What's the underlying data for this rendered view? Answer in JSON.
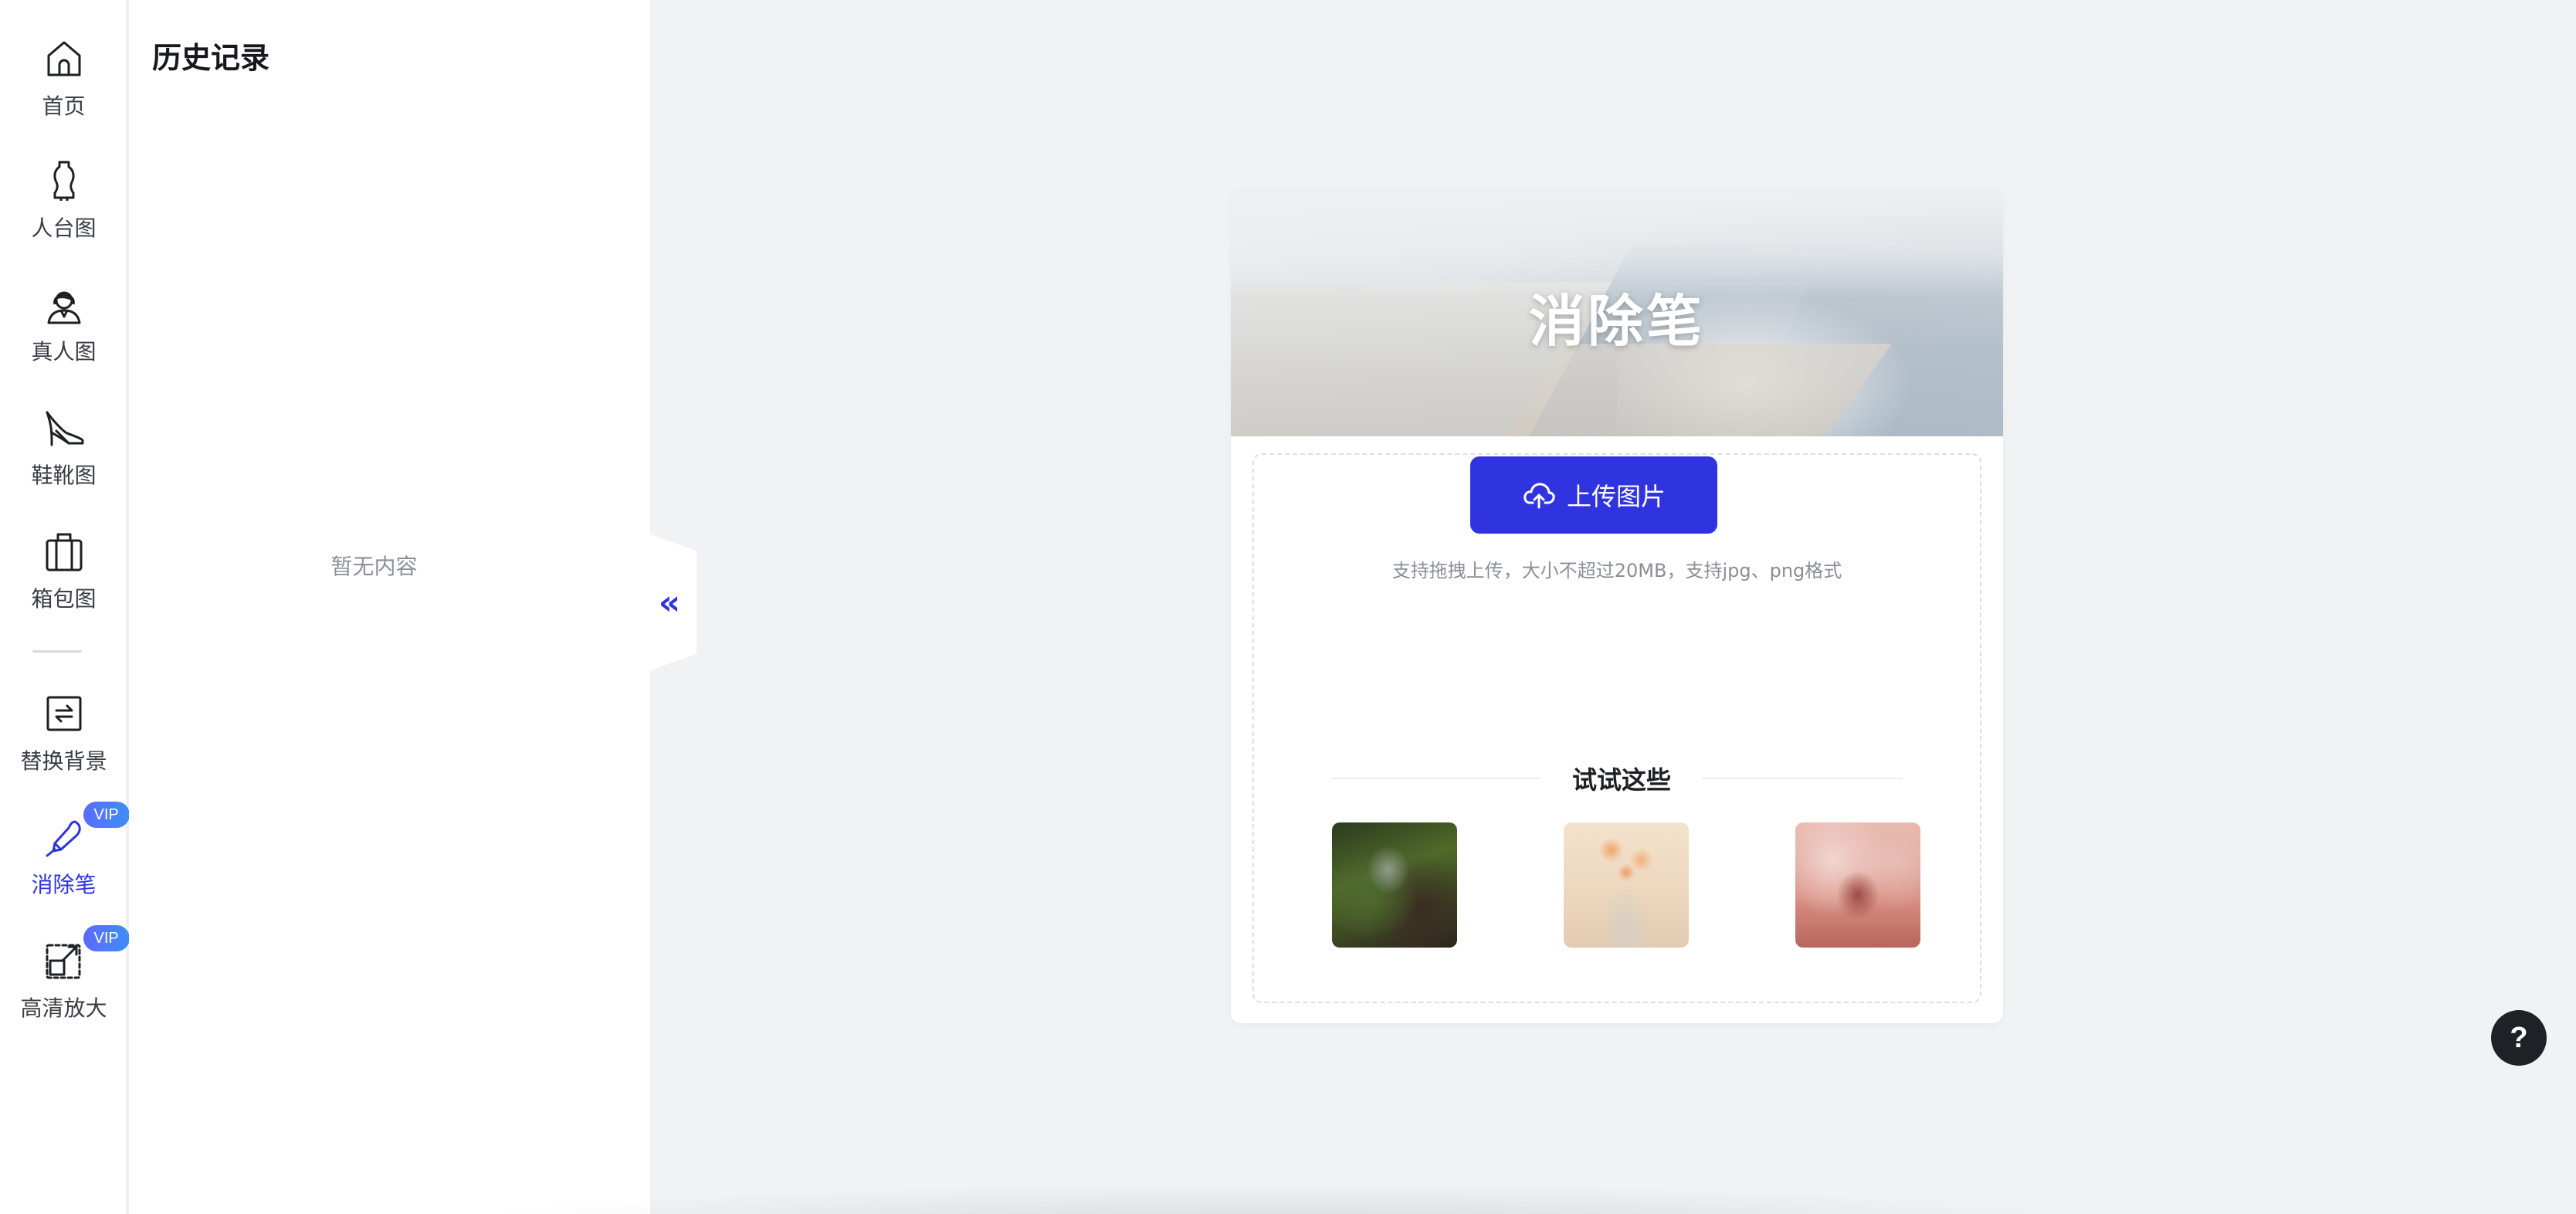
{
  "nav": {
    "items": [
      {
        "label": "首页",
        "icon": "home-icon",
        "vip": ""
      },
      {
        "label": "人台图",
        "icon": "mannequin-icon",
        "vip": ""
      },
      {
        "label": "真人图",
        "icon": "person-icon",
        "vip": ""
      },
      {
        "label": "鞋靴图",
        "icon": "high-heel-icon",
        "vip": ""
      },
      {
        "label": "箱包图",
        "icon": "suitcase-icon",
        "vip": ""
      },
      {
        "label": "替换背景",
        "icon": "swap-background-icon",
        "vip": ""
      },
      {
        "label": "消除笔",
        "icon": "eraser-pen-icon",
        "vip": "VIP",
        "active": true
      },
      {
        "label": "高清放大",
        "icon": "upscale-icon",
        "vip": "VIP"
      }
    ]
  },
  "history": {
    "title": "历史记录",
    "empty_text": "暂无内容",
    "collapse_icon": "double-chevron-left-icon",
    "collapse_glyph": "«"
  },
  "card": {
    "banner_title": "消除笔",
    "upload_label": "上传图片",
    "upload_icon": "cloud-upload-icon",
    "hint": "支持拖拽上传，大小不超过20MB，支持jpg、png格式",
    "try_title": "试试这些",
    "samples": [
      {
        "name": "sneaker-on-rock-sample"
      },
      {
        "name": "dried-flowers-sample"
      },
      {
        "name": "pink-handbag-sample"
      }
    ]
  },
  "help": {
    "label": "?"
  },
  "colors": {
    "accent": "#3034e0",
    "rail_bg": "#ffffff",
    "main_bg": "#f1f2f4",
    "vip_gradient_start": "#5b6bff",
    "vip_gradient_end": "#3f8ef5"
  }
}
